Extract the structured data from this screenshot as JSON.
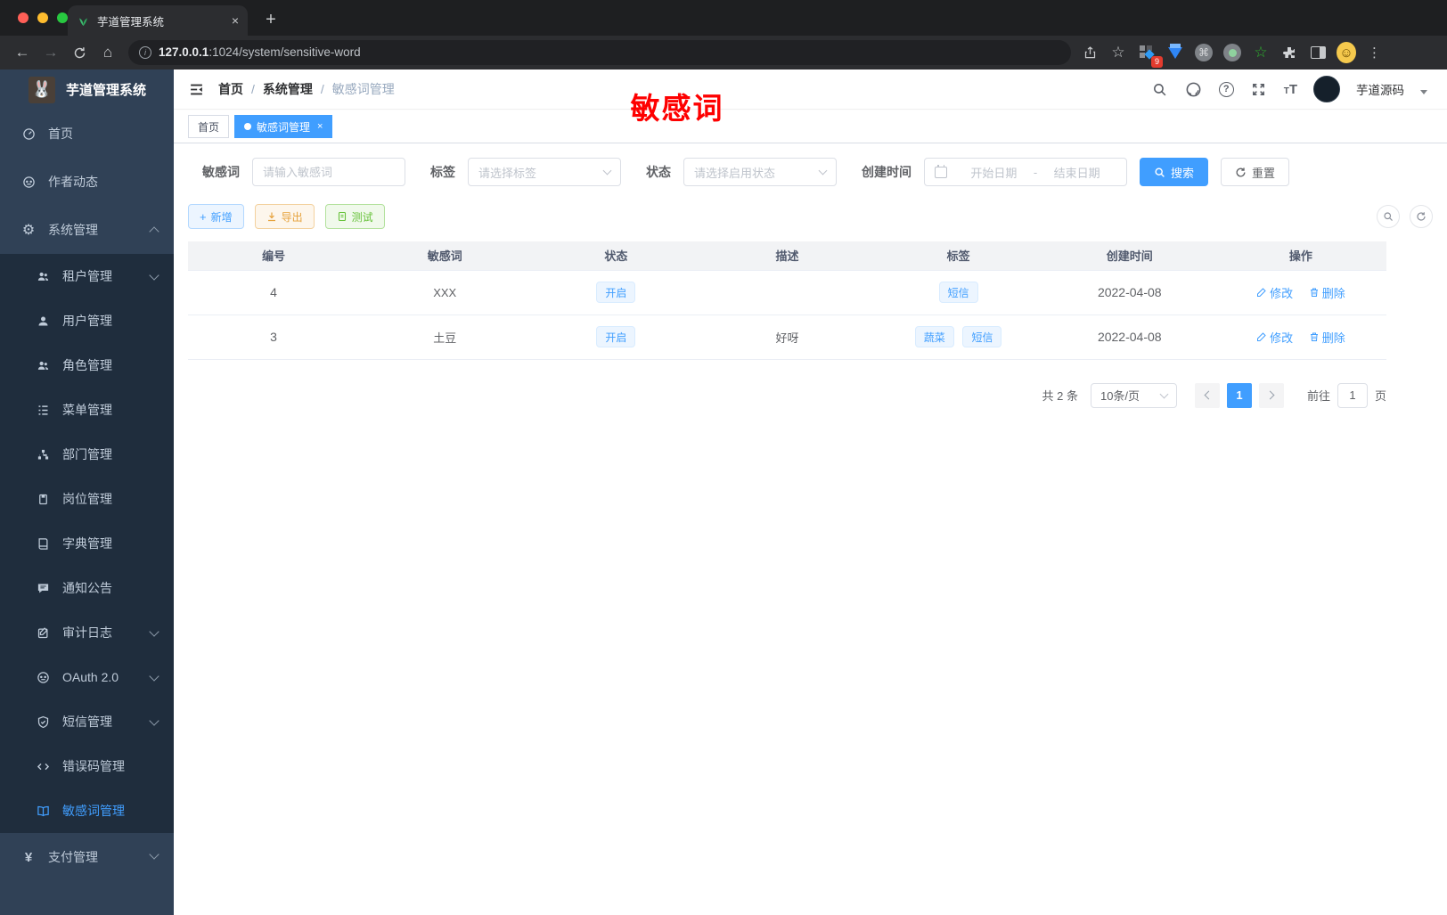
{
  "colors": {
    "accent": "#409eff",
    "annotation_red": "#fe0000",
    "sidebar_bg": "#304156",
    "submenu_bg": "#1f2d3d"
  },
  "browser": {
    "tab_title": "芋道管理系统",
    "url_host": "127.0.0.1",
    "url_rest": ":1024/system/sensitive-word",
    "extension_badge": "9"
  },
  "sidebar": {
    "title": "芋道管理系统",
    "items": [
      {
        "label": "首页"
      },
      {
        "label": "作者动态"
      },
      {
        "label": "系统管理"
      },
      {
        "label": "租户管理"
      },
      {
        "label": "用户管理"
      },
      {
        "label": "角色管理"
      },
      {
        "label": "菜单管理"
      },
      {
        "label": "部门管理"
      },
      {
        "label": "岗位管理"
      },
      {
        "label": "字典管理"
      },
      {
        "label": "通知公告"
      },
      {
        "label": "审计日志"
      },
      {
        "label": "OAuth 2.0"
      },
      {
        "label": "短信管理"
      },
      {
        "label": "错误码管理"
      },
      {
        "label": "敏感词管理"
      },
      {
        "label": "支付管理"
      }
    ]
  },
  "header": {
    "breadcrumb": [
      "首页",
      "系统管理",
      "敏感词管理"
    ],
    "separator": "/",
    "annotation": "敏感词",
    "username": "芋道源码"
  },
  "tabs": [
    {
      "label": "首页"
    },
    {
      "label": "敏感词管理"
    }
  ],
  "filters": {
    "keyword_label": "敏感词",
    "keyword_placeholder": "请输入敏感词",
    "tag_label": "标签",
    "tag_placeholder": "请选择标签",
    "status_label": "状态",
    "status_placeholder": "请选择启用状态",
    "date_label": "创建时间",
    "date_start_placeholder": "开始日期",
    "date_separator": "-",
    "date_end_placeholder": "结束日期",
    "search_label": "搜索",
    "reset_label": "重置"
  },
  "toolbar": {
    "add_label": "新增",
    "export_label": "导出",
    "test_label": "测试"
  },
  "table": {
    "columns": [
      "编号",
      "敏感词",
      "状态",
      "描述",
      "标签",
      "创建时间",
      "操作"
    ],
    "rows": [
      {
        "id": "4",
        "word": "XXX",
        "status": "开启",
        "desc": "",
        "tags": [
          "短信"
        ],
        "created": "2022-04-08"
      },
      {
        "id": "3",
        "word": "土豆",
        "status": "开启",
        "desc": "好呀",
        "tags": [
          "蔬菜",
          "短信"
        ],
        "created": "2022-04-08"
      }
    ],
    "actions": {
      "edit": "修改",
      "delete": "删除"
    }
  },
  "pagination": {
    "total": "共 2 条",
    "page_size": "10条/页",
    "current_page": "1",
    "goto_label": "前往",
    "goto_value": "1",
    "page_unit": "页"
  }
}
